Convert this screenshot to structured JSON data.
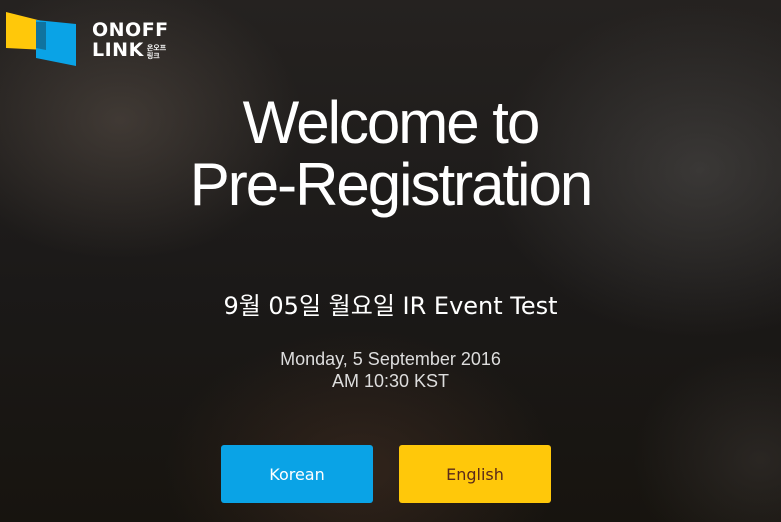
{
  "logo": {
    "brand_line1": "ONOFF",
    "brand_line2": "LINK",
    "brand_korean": "온오프\n링크",
    "colors": {
      "yellow": "#ffc80a",
      "blue": "#0aa3e6"
    }
  },
  "headline": {
    "line1": "Welcome to",
    "line2": "Pre-Registration"
  },
  "event": {
    "title": "9월 05일 월요일 IR Event Test",
    "date_line1": "Monday, 5 September 2016",
    "date_line2": "AM 10:30 KST"
  },
  "buttons": {
    "korean": {
      "label": "Korean",
      "color": "#0aa3e6"
    },
    "english": {
      "label": "English",
      "color": "#ffc80a"
    }
  }
}
